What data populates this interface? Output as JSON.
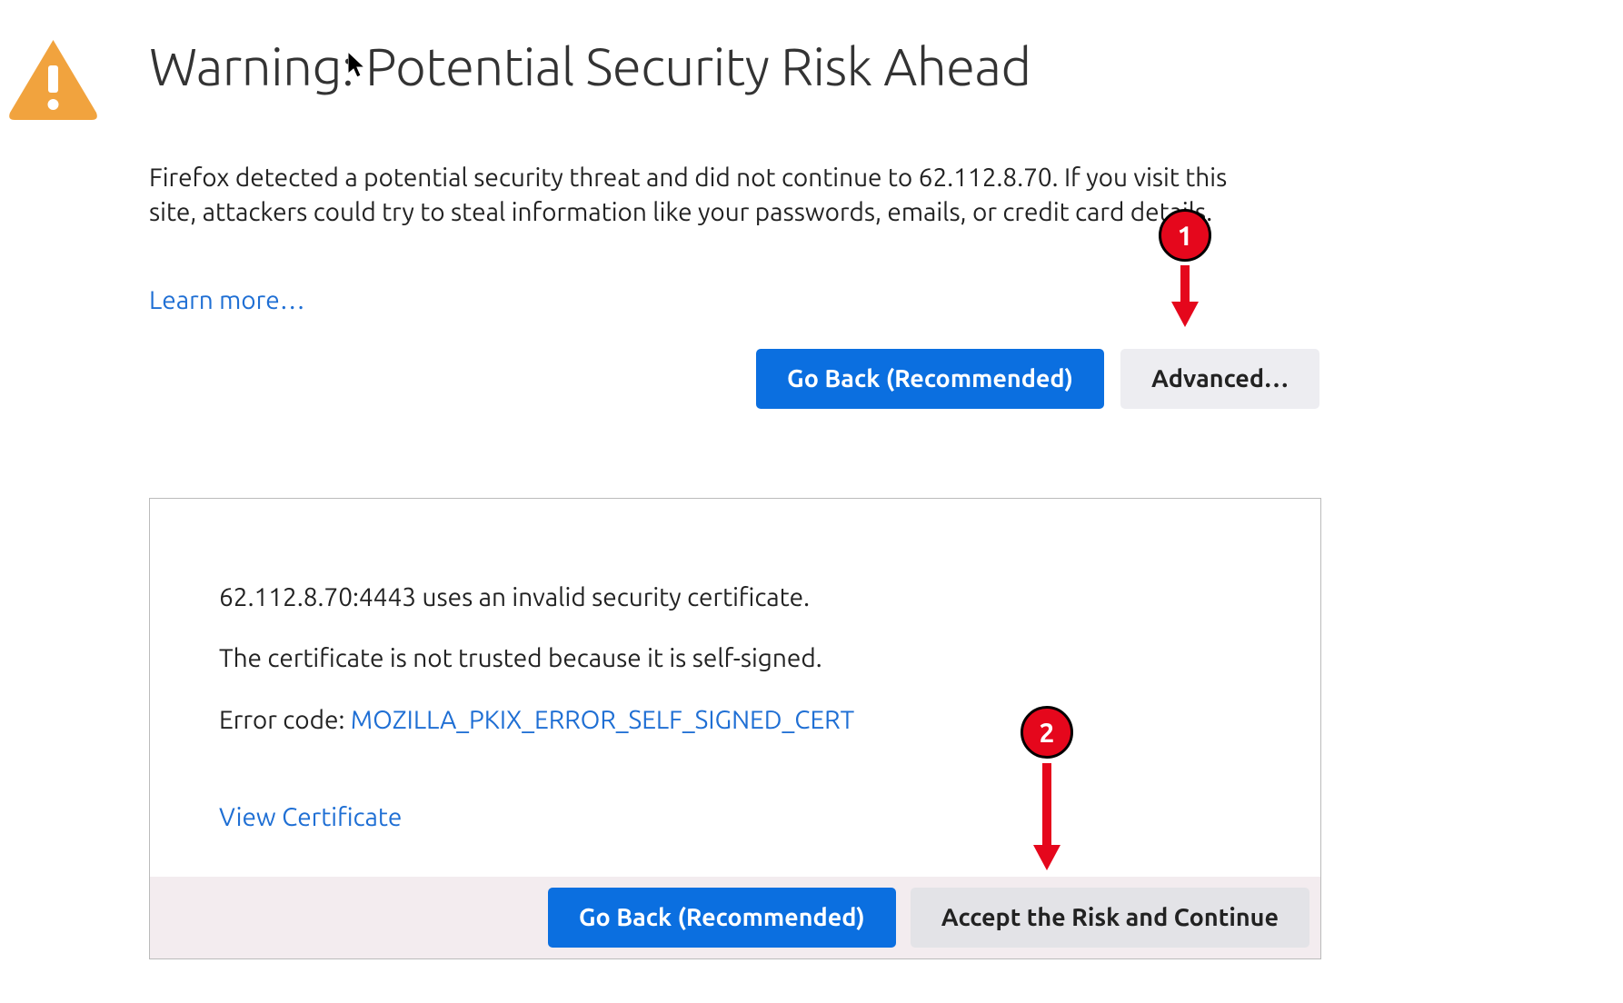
{
  "main": {
    "title": "Warning: Potential Security Risk Ahead",
    "description": "Firefox detected a potential security threat and did not continue to 62.112.8.70. If you visit this site, attackers could try to steal information like your passwords, emails, or credit card details.",
    "learn_more": "Learn more…",
    "go_back_button": "Go Back (Recommended)",
    "advanced_button": "Advanced…"
  },
  "advanced_panel": {
    "line1": "62.112.8.70:4443 uses an invalid security certificate.",
    "line2": "The certificate is not trusted because it is self-signed.",
    "error_code_label": "Error code: ",
    "error_code": "MOZILLA_PKIX_ERROR_SELF_SIGNED_CERT",
    "view_certificate": "View Certificate",
    "go_back_button": "Go Back (Recommended)",
    "accept_button": "Accept the Risk and Continue"
  },
  "annotations": {
    "badge1": "1",
    "badge2": "2"
  }
}
